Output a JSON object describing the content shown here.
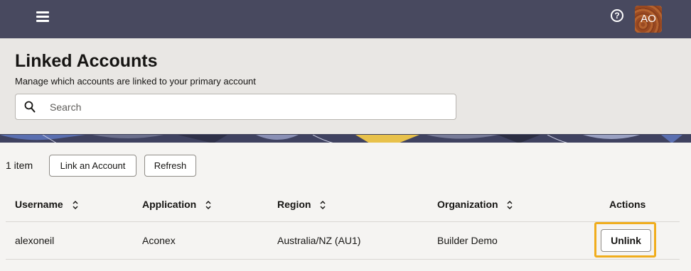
{
  "topbar": {
    "menu_icon": "hamburger-menu-icon",
    "help_icon": "help-circle-icon",
    "avatar_initials": "AO"
  },
  "page": {
    "title": "Linked Accounts",
    "subtitle": "Manage which accounts are linked to your primary account"
  },
  "search": {
    "placeholder": "Search",
    "value": "",
    "icon": "search-icon"
  },
  "toolbar": {
    "item_count": "1 item",
    "link_account_label": "Link an Account",
    "refresh_label": "Refresh"
  },
  "table": {
    "columns": {
      "username": "Username",
      "application": "Application",
      "region": "Region",
      "organization": "Organization",
      "actions": "Actions"
    },
    "rows": [
      {
        "username": "alexoneil",
        "application": "Aconex",
        "region": "Australia/NZ (AU1)",
        "organization": "Builder Demo",
        "action_label": "Unlink"
      }
    ]
  },
  "colors": {
    "topbar": "#48495f",
    "header_area": "#e9e7e4",
    "focus_ring": "#f0ad1d"
  }
}
